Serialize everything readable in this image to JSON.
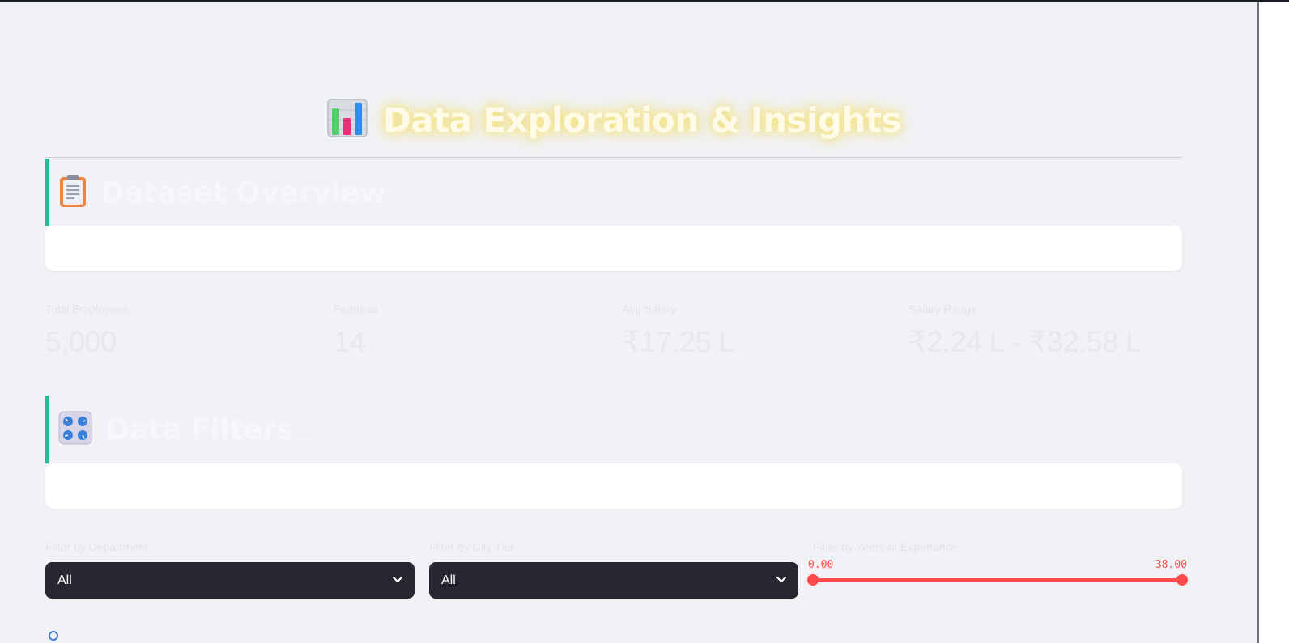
{
  "page": {
    "title": "Data Exploration & Insights",
    "title_icon": "bar-chart-icon"
  },
  "dataset_overview": {
    "heading": "Dataset Overview",
    "icon": "clipboard-icon",
    "metrics": [
      {
        "label": "Total Employees",
        "value": "5,000"
      },
      {
        "label": "Features",
        "value": "14"
      },
      {
        "label": "Avg Salary",
        "value": "₹17.25 L"
      },
      {
        "label": "Salary Range",
        "value": "₹2.24 L - ₹32.58 L"
      }
    ]
  },
  "data_filters": {
    "heading": "Data Filters",
    "subtext": "—",
    "icon": "control-knobs-icon",
    "department": {
      "label": "Filter by Department",
      "value": "All"
    },
    "city_tier": {
      "label": "Filter by City Tier",
      "value": "All"
    },
    "experience": {
      "label": "Filter by Years of Experiance",
      "min": "0.00",
      "max": "38.00",
      "range": [
        0,
        38
      ]
    }
  },
  "colors": {
    "accent": "#ff4b4b",
    "section_border": "#1fbf9a",
    "select_bg": "#262730",
    "background": "#f0f2f6"
  }
}
